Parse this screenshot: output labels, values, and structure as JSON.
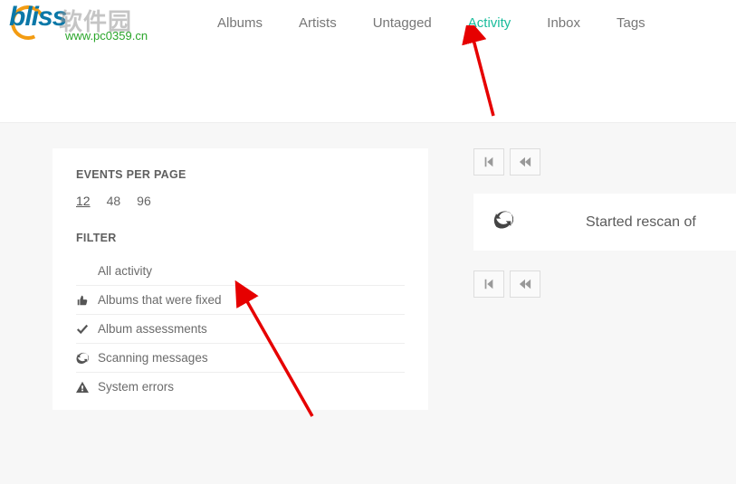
{
  "logo": {
    "text": "bliss",
    "overlay": "软件园",
    "url": "www.pc0359.cn"
  },
  "nav": {
    "items": [
      {
        "label": "Albums",
        "active": false
      },
      {
        "label": "Artists",
        "active": false
      },
      {
        "label": "Untagged",
        "active": false
      },
      {
        "label": "Activity",
        "active": true
      },
      {
        "label": "Inbox",
        "active": false
      },
      {
        "label": "Tags",
        "active": false
      }
    ]
  },
  "sidebar": {
    "events_heading": "EVENTS PER PAGE",
    "page_sizes": [
      "12",
      "48",
      "96"
    ],
    "page_size_selected": "12",
    "filter_heading": "FILTER",
    "filters": [
      {
        "icon": "",
        "label": "All activity"
      },
      {
        "icon": "thumbs-up",
        "label": "Albums that were fixed"
      },
      {
        "icon": "check",
        "label": "Album assessments"
      },
      {
        "icon": "refresh",
        "label": "Scanning messages"
      },
      {
        "icon": "warning",
        "label": "System errors"
      }
    ]
  },
  "activity": {
    "items": [
      {
        "icon": "refresh",
        "text": "Started rescan of"
      }
    ]
  }
}
